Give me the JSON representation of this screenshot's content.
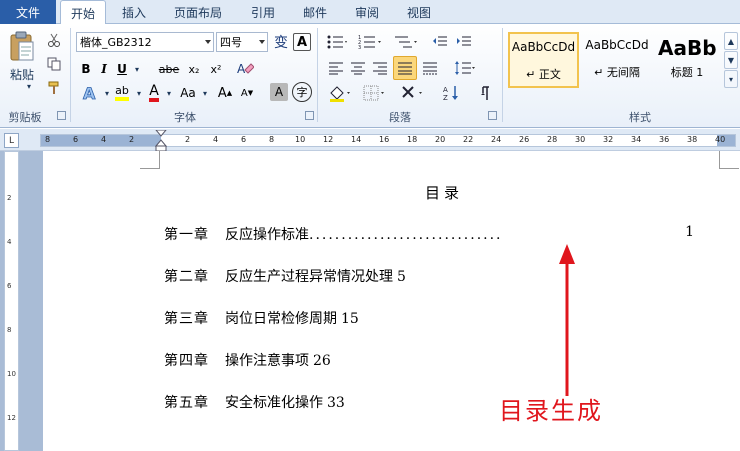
{
  "tabs": {
    "file": "文件",
    "items": [
      "开始",
      "插入",
      "页面布局",
      "引用",
      "邮件",
      "审阅",
      "视图"
    ],
    "active": "开始"
  },
  "clipboard": {
    "paste_label": "粘贴",
    "group_label": "剪贴板"
  },
  "font": {
    "name_value": "楷体_GB2312",
    "size_value": "四号",
    "group_label": "字体",
    "bold": "B",
    "italic": "I",
    "underline": "U",
    "strike": "abe",
    "subscript": "x₂",
    "superscript": "x²",
    "grow": "A",
    "shrink": "A",
    "case": "Aa",
    "char_shade": "A",
    "enclose": "字",
    "wen_label": "变",
    "font_color": "A",
    "highlight": "ab"
  },
  "paragraph": {
    "group_label": "段落"
  },
  "styles": {
    "group_label": "样式",
    "items": [
      {
        "sample": "AaBbCcDd",
        "name": "↵ 正文"
      },
      {
        "sample": "AaBbCcDd",
        "name": "↵ 无间隔"
      },
      {
        "sample": "AaBb",
        "name": "标题 1"
      }
    ]
  },
  "ruler": {
    "corner": "L",
    "numbers": [
      "8",
      "6",
      "4",
      "2",
      "",
      "2",
      "4",
      "6",
      "8",
      "10",
      "12",
      "14",
      "16",
      "18",
      "20",
      "22",
      "24",
      "26",
      "28",
      "30",
      "32",
      "34",
      "36",
      "38",
      "40"
    ],
    "vnumbers": [
      "",
      "2",
      "",
      "4",
      "",
      "6",
      "",
      "8",
      "",
      "10",
      "",
      "12"
    ]
  },
  "document": {
    "title": "目录",
    "toc": [
      {
        "chapter": "第一章",
        "text": "反应操作标准",
        "leader": "..............................",
        "page": "1"
      },
      {
        "chapter": "第二章",
        "text": "反应生产过程异常情况处理",
        "leader": "",
        "page": "5"
      },
      {
        "chapter": "第三章",
        "text": "岗位日常检修周期",
        "leader": "",
        "page": "15"
      },
      {
        "chapter": "第四章",
        "text": "操作注意事项",
        "leader": "",
        "page": "26"
      },
      {
        "chapter": "第五章",
        "text": "安全标准化操作",
        "leader": "",
        "page": "33"
      }
    ]
  },
  "annotation": {
    "text": "目录生成",
    "color": "#e0161d"
  },
  "colors": {
    "accent": "#2a5ea8",
    "ribbon": "#dfe9f5",
    "workspace": "#a9bcd6",
    "selected": "#fbd77b"
  }
}
